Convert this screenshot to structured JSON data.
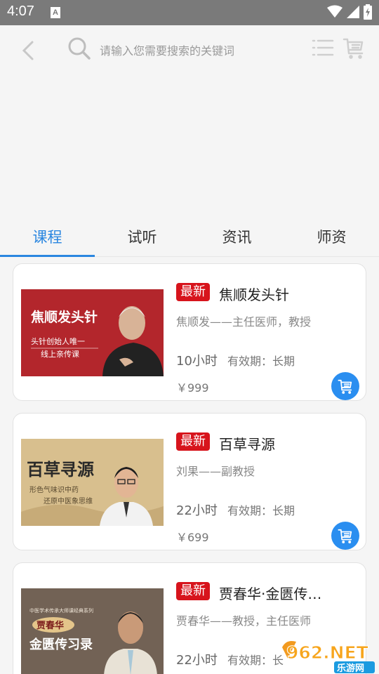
{
  "status_bar": {
    "time": "4:07",
    "notification_icon": "A"
  },
  "search": {
    "placeholder": "请输入您需要搜索的关键词"
  },
  "tabs": [
    {
      "label": "课程",
      "active": true
    },
    {
      "label": "试听",
      "active": false
    },
    {
      "label": "资讯",
      "active": false
    },
    {
      "label": "师资",
      "active": false
    }
  ],
  "courses": [
    {
      "badge": "最新",
      "title": "焦顺发头针",
      "teacher": "焦顺发——主任医师，教授",
      "hours": "10小时",
      "validity": "有效期：长期",
      "price": "￥999",
      "thumb_title": "焦顺发头针",
      "thumb_sub1": "头针创始人唯一",
      "thumb_sub2": "线上亲传课"
    },
    {
      "badge": "最新",
      "title": "百草寻源",
      "teacher": "刘果——副教授",
      "hours": "22小时",
      "validity": "有效期：长期",
      "price": "￥699",
      "thumb_title": "百草寻源",
      "thumb_sub1": "形色气味识中药",
      "thumb_sub2": "还原中医象思维"
    },
    {
      "badge": "最新",
      "title": "贾春华·金匮传…",
      "teacher": "贾春华——教授，主任医师",
      "hours": "22小时",
      "validity": "有效期：长",
      "price": "",
      "thumb_top": "中医学术传承大师课经典系列",
      "thumb_name": "贾春华",
      "thumb_title": "金匮传习录"
    }
  ],
  "watermark": {
    "text": "962.NET",
    "sub": "乐游网"
  },
  "colors": {
    "accent": "#2a86e0",
    "badge": "#d7141c",
    "cart": "#2a8ef0"
  }
}
